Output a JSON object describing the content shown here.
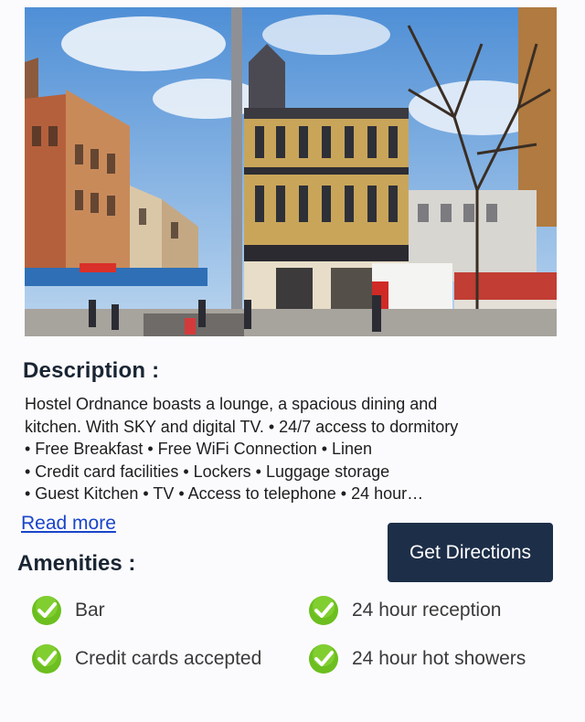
{
  "photo": {
    "alt_icon": "street-photo"
  },
  "description": {
    "heading": "Description :",
    "line1": "Hostel Ordnance boasts a lounge, a spacious dining and",
    "line2": "kitchen. With SKY and digital TV. • 24/7 access to dormitory",
    "line3": "• Free Breakfast • Free WiFi Connection • Linen",
    "line4": "• Credit card facilities • Lockers • Luggage storage",
    "line5": "• Guest Kitchen • TV • Access to telephone • 24 hour…",
    "read_more": "Read more"
  },
  "directions_label": "Get Directions",
  "amenities": {
    "heading": "Amenities :",
    "items": [
      "Bar",
      "24 hour reception",
      "Credit cards accepted",
      "24 hour hot showers"
    ]
  },
  "colors": {
    "button": "#1d2e48",
    "link": "#1a45c9",
    "check": "#6cbf1f"
  }
}
